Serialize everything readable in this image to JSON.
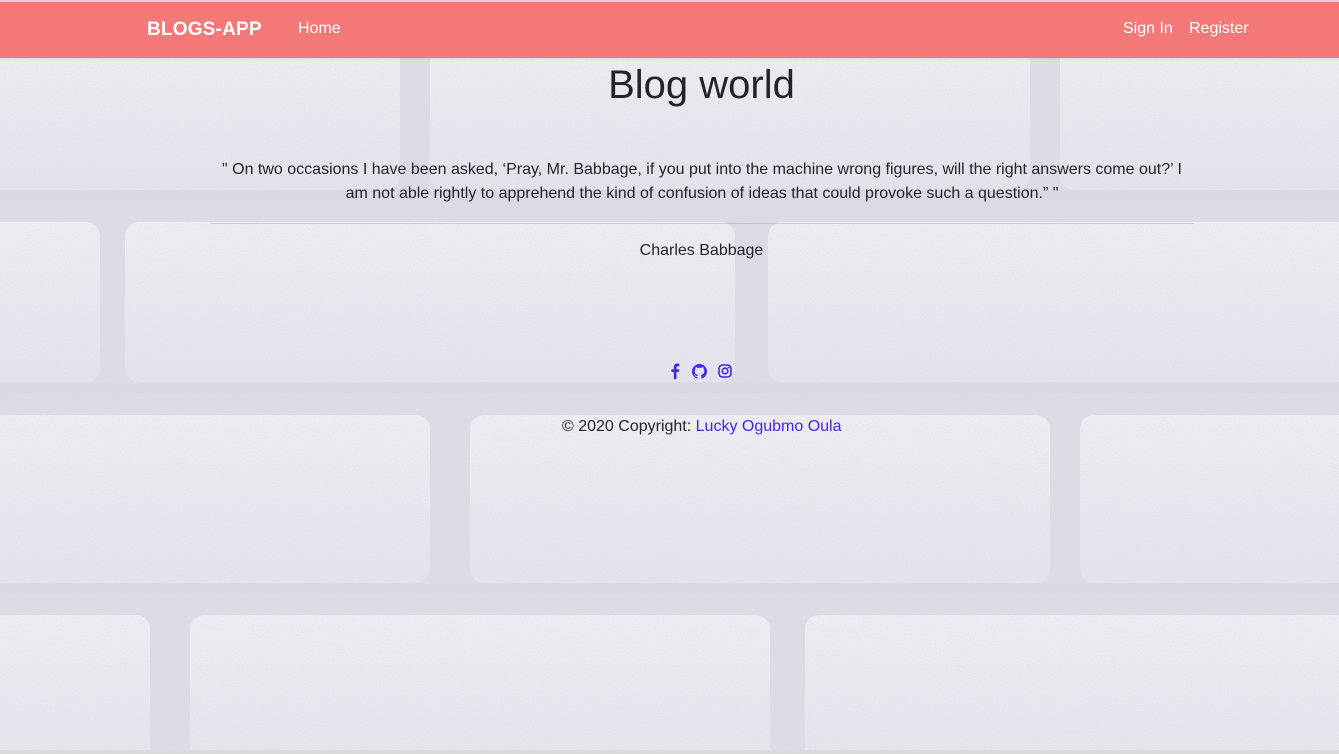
{
  "navbar": {
    "brand": "BLOGS-APP",
    "home_label": "Home",
    "signin_label": "Sign In",
    "register_label": "Register",
    "background_color": "#f57878"
  },
  "main": {
    "title": "Blog world",
    "quote": "\" On two occasions I have been asked, ‘Pray, Mr. Babbage, if you put into the machine wrong figures, will the right answers come out?’ I am not able rightly to apprehend the kind of confusion of ideas that could provoke such a question.” \"",
    "author": "Charles Babbage"
  },
  "footer": {
    "social_icons": [
      "facebook-icon",
      "github-icon",
      "instagram-icon"
    ],
    "copyright_prefix": "© 2020 Copyright: ",
    "copyright_link": "Lucky Ogubmo Oula",
    "link_color": "#4a24ee"
  }
}
